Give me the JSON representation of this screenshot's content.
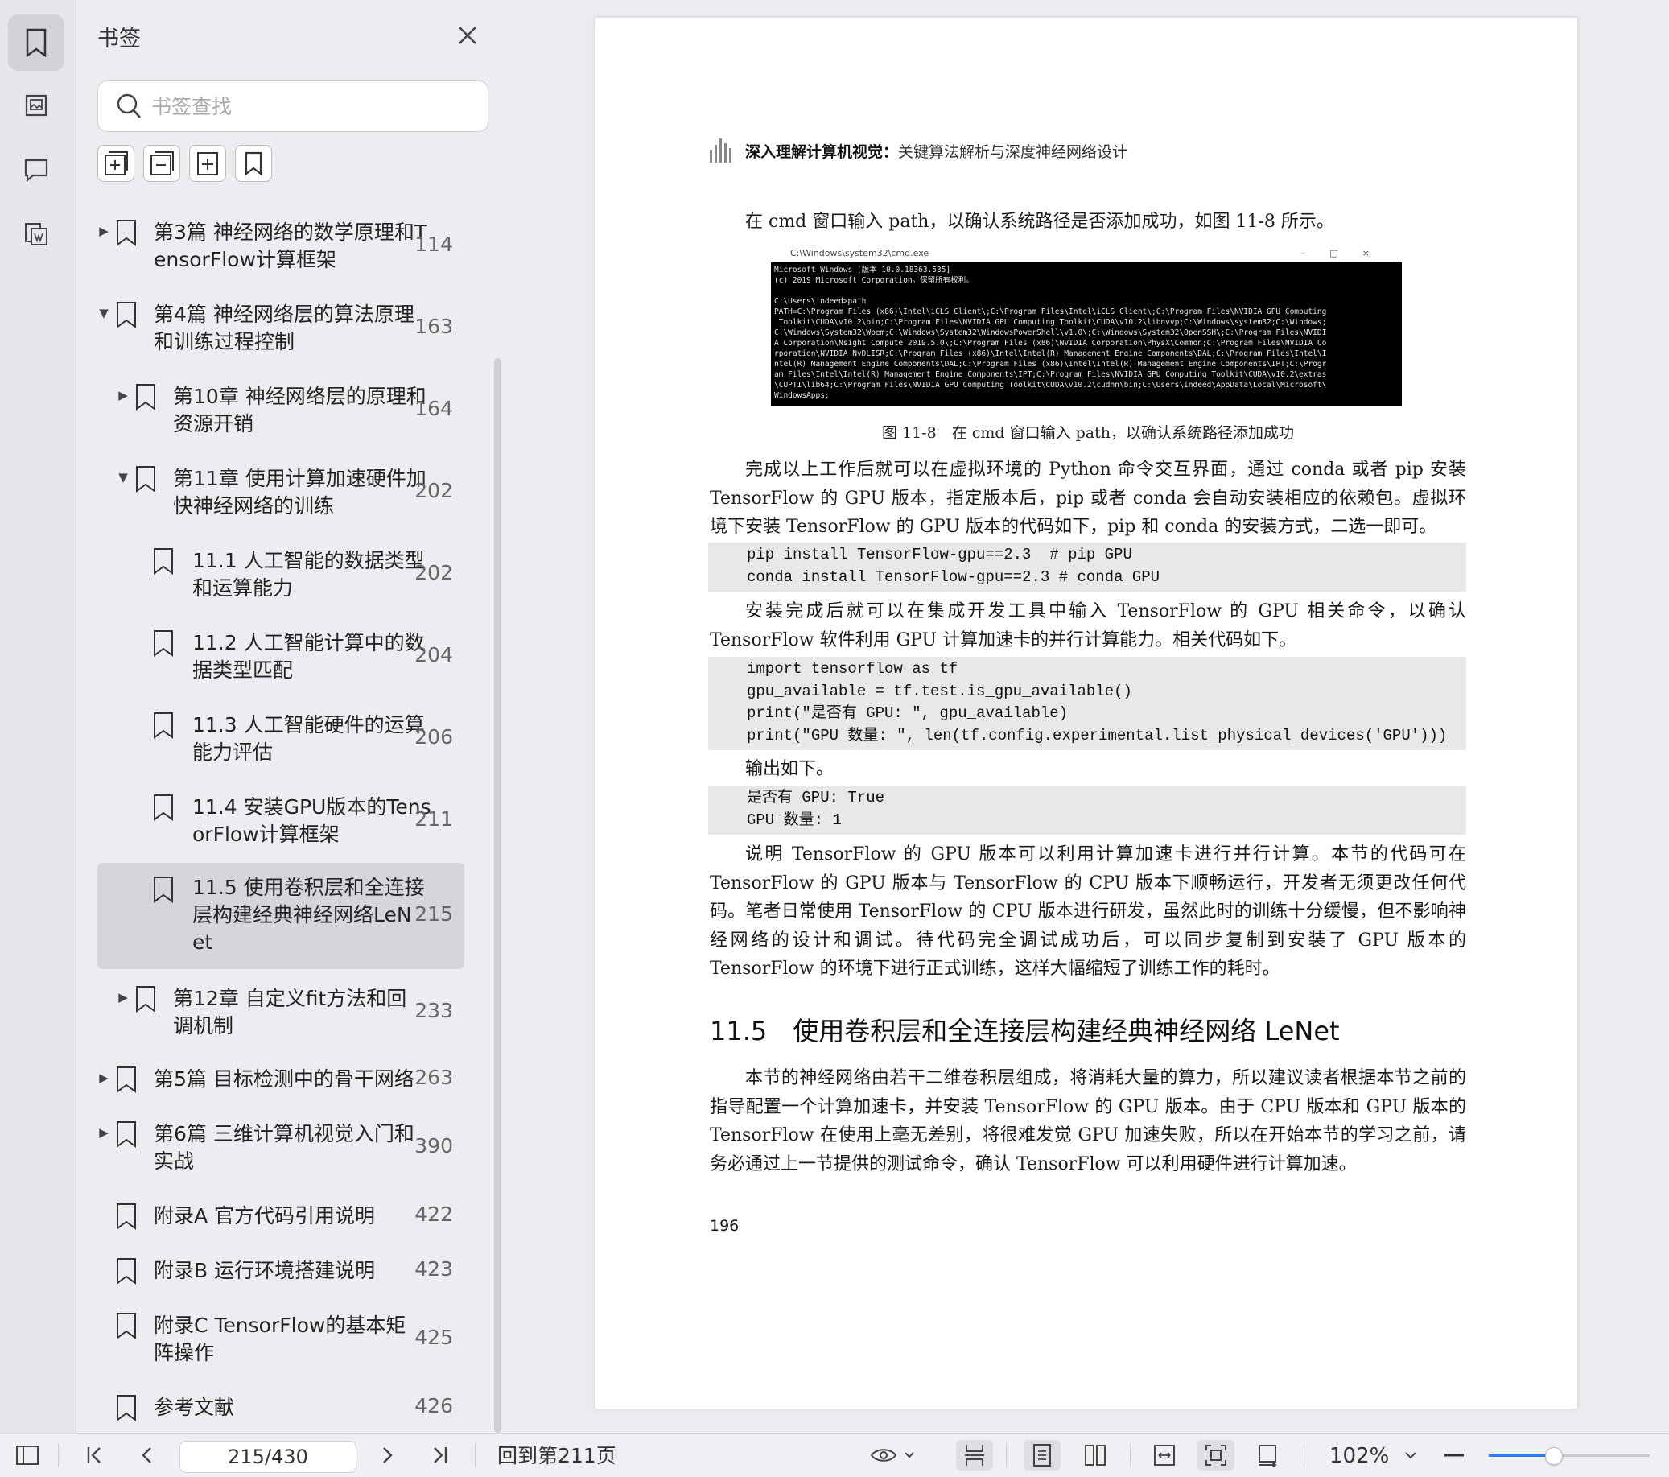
{
  "sidebar": {
    "title": "书签",
    "search_placeholder": "书签查找",
    "bookmarks": [
      {
        "label1": "第3篇 神经网络的数学原理和T",
        "label2": "ensorFlow计算框架",
        "page": "114"
      },
      {
        "label1": "第4篇 神经网络层的算法原理",
        "label2": "和训练过程控制",
        "page": "163"
      },
      {
        "label1": "第10章 神经网络层的原理和",
        "label2": "资源开销",
        "page": "164"
      },
      {
        "label1": "第11章 使用计算加速硬件加",
        "label2": "快神经网络的训练",
        "page": "202"
      },
      {
        "label1": "11.1 人工智能的数据类型",
        "label2": "和运算能力",
        "page": "202"
      },
      {
        "label1": "11.2 人工智能计算中的数",
        "label2": "据类型匹配",
        "page": "204"
      },
      {
        "label1": "11.3 人工智能硬件的运算",
        "label2": "能力评估",
        "page": "206"
      },
      {
        "label1": "11.4 安装GPU版本的Tens",
        "label2": "orFlow计算框架",
        "page": "211"
      },
      {
        "label1": "11.5 使用卷积层和全连接",
        "label2": "层构建经典神经网络LeN",
        "label3": "et",
        "page": "215"
      },
      {
        "label1": "第12章 自定义fit方法和回",
        "label2": "调机制",
        "page": "233"
      },
      {
        "label1": "第5篇 目标检测中的骨干网络",
        "page": "263"
      },
      {
        "label1": "第6篇 三维计算机视觉入门和",
        "label2": "实战",
        "page": "390"
      },
      {
        "label1": "附录A 官方代码引用说明",
        "page": "422"
      },
      {
        "label1": "附录B 运行环境搭建说明",
        "page": "423"
      },
      {
        "label1": "附录C TensorFlow的基本矩",
        "label2": "阵操作",
        "page": "425"
      },
      {
        "label1": "参考文献",
        "page": "426"
      }
    ]
  },
  "document": {
    "header_bold": "深入理解计算机视觉：",
    "header_rest": "关键算法解析与深度神经网络设计",
    "p1": "在 cmd 窗口输入 path，以确认系统路径是否添加成功，如图 11-8 所示。",
    "cmd_title": "C:\\Windows\\system32\\cmd.exe",
    "cmd_text": "Microsoft Windows [版本 10.0.18363.535]\n(c) 2019 Microsoft Corporation。保留所有权利。\n\nC:\\Users\\indeed>path\nPATH=C:\\Program Files (x86)\\Intel\\iCLS Client\\;C:\\Program Files\\Intel\\iCLS Client\\;C:\\Program Files\\NVIDIA GPU Computing\n Toolkit\\CUDA\\v10.2\\bin;C:\\Program Files\\NVIDIA GPU Computing Toolkit\\CUDA\\v10.2\\libnvvp;C:\\Windows\\system32;C:\\Windows;\nC:\\Windows\\System32\\Wbem;C:\\Windows\\System32\\WindowsPowerShell\\v1.0\\;C:\\Windows\\System32\\OpenSSH\\;C:\\Program Files\\NVIDI\nA Corporation\\Nsight Compute 2019.5.0\\;C:\\Program Files (x86)\\NVIDIA Corporation\\PhysX\\Common;C:\\Program Files\\NVIDIA Co\nrporation\\NVIDIA NvDLISR;C:\\Program Files (x86)\\Intel\\Intel(R) Management Engine Components\\DAL;C:\\Program Files\\Intel\\I\nntel(R) Management Engine Components\\DAL;C:\\Program Files (x86)\\Intel\\Intel(R) Management Engine Components\\IPT;C:\\Progr\nam Files\\Intel\\Intel(R) Management Engine Components\\IPT;C:\\Program Files\\NVIDIA GPU Computing Toolkit\\CUDA\\v10.2\\extras\n\\CUPTI\\lib64;C:\\Program Files\\NVIDIA GPU Computing Toolkit\\CUDA\\v10.2\\cudnn\\bin;C:\\Users\\indeed\\AppData\\Local\\Microsoft\\\nWindowsApps;",
    "caption": "图 11-8　在 cmd 窗口输入 path，以确认系统路径添加成功",
    "p2": "完成以上工作后就可以在虚拟环境的 Python 命令交互界面，通过 conda 或者 pip 安装 TensorFlow 的 GPU 版本，指定版本后，pip 或者 conda 会自动安装相应的依赖包。虚拟环境下安装 TensorFlow 的 GPU 版本的代码如下，pip 和 conda 的安装方式，二选一即可。",
    "code1": "pip install TensorFlow-gpu==2.3  # pip GPU\nconda install TensorFlow-gpu==2.3 # conda GPU",
    "p3": "安装完成后就可以在集成开发工具中输入 TensorFlow 的 GPU 相关命令，以确认 TensorFlow 软件利用 GPU 计算加速卡的并行计算能力。相关代码如下。",
    "code2": "import tensorflow as tf\ngpu_available = tf.test.is_gpu_available()\nprint(\"是否有 GPU: \", gpu_available)\nprint(\"GPU 数量: \", len(tf.config.experimental.list_physical_devices('GPU')))",
    "p4": "输出如下。",
    "code3": "是否有 GPU: True\nGPU 数量: 1",
    "p5": "说明 TensorFlow 的 GPU 版本可以利用计算加速卡进行并行计算。本节的代码可在 TensorFlow 的 GPU 版本与 TensorFlow 的 CPU 版本下顺畅运行，开发者无须更改任何代码。笔者日常使用 TensorFlow 的 CPU 版本进行研发，虽然此时的训练十分缓慢，但不影响神经网络的设计和调试。待代码完全调试成功后，可以同步复制到安装了 GPU 版本的 TensorFlow 的环境下进行正式训练，这样大幅缩短了训练工作的耗时。",
    "heading": "11.5　使用卷积层和全连接层构建经典神经网络 LeNet",
    "p6": "本节的神经网络由若干二维卷积层组成，将消耗大量的算力，所以建议读者根据本节之前的指导配置一个计算加速卡，并安装 TensorFlow 的 GPU 版本。由于 CPU 版本和 GPU 版本的 TensorFlow 在使用上毫无差别，将很难发觉 GPU 加速失败，所以在开始本节的学习之前，请务必通过上一节提供的测试命令，确认 TensorFlow 可以利用硬件进行计算加速。",
    "page_number": "196"
  },
  "statusbar": {
    "page_field": "215/430",
    "goto": "回到第211页",
    "zoom": "102%",
    "zoom_level": 0.4
  }
}
